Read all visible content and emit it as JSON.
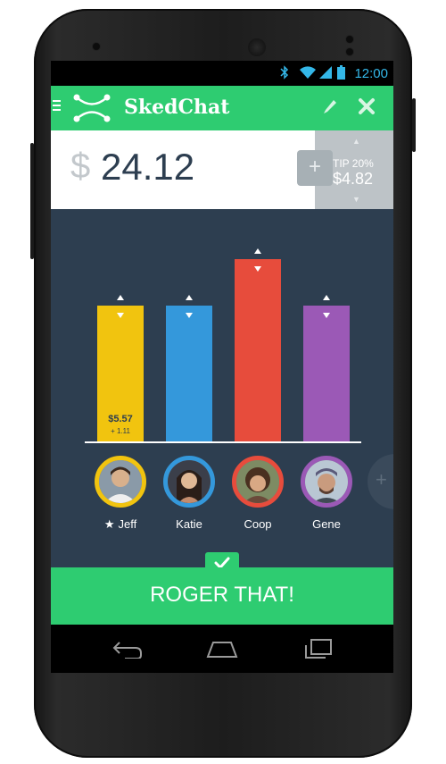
{
  "status_bar": {
    "time": "12:00"
  },
  "app": {
    "title": "SkedChat"
  },
  "bill": {
    "currency": "$",
    "amount": "24.12"
  },
  "tip": {
    "label": "TIP 20%",
    "amount": "$4.82"
  },
  "people": [
    {
      "name": "Jeff",
      "color": "#f1c40f",
      "starred": true,
      "amount": "$5.57",
      "extra": "+ 1.11"
    },
    {
      "name": "Katie",
      "color": "#3498db",
      "starred": false
    },
    {
      "name": "Coop",
      "color": "#e74c3c",
      "starred": false
    },
    {
      "name": "Gene",
      "color": "#9b59b6",
      "starred": false
    }
  ],
  "icons": {
    "bluetooth": "bluetooth-icon",
    "wifi": "wifi-icon",
    "signal": "signal-icon",
    "battery": "battery-icon",
    "menu": "menu-icon",
    "logo": "logo-icon",
    "edit": "pencil-icon",
    "close": "close-icon",
    "add_person": "plus-icon",
    "confirm": "checkmark-icon"
  },
  "action": {
    "confirm_label": "ROGER THAT!"
  },
  "colors": {
    "accent": "#2ecc71",
    "background": "#2d3e50"
  }
}
